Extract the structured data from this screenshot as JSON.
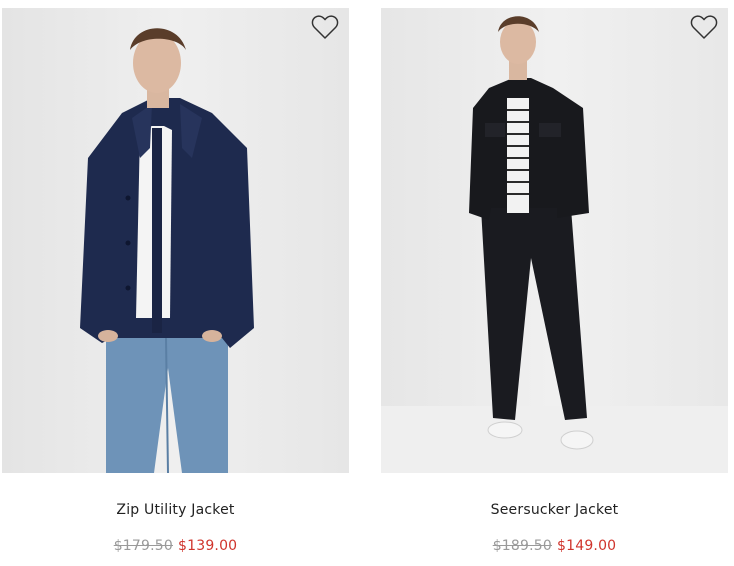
{
  "products": [
    {
      "name": "Zip Utility Jacket",
      "original_price": "$179.50",
      "sale_price": "$139.00",
      "wishlist_icon": "heart-outline-icon"
    },
    {
      "name": "Seersucker Jacket",
      "original_price": "$189.50",
      "sale_price": "$149.00",
      "wishlist_icon": "heart-outline-icon"
    }
  ],
  "colors": {
    "name_text": "#222222",
    "original_price": "#9a9a9a",
    "sale_price": "#d0342c",
    "photo_background": "#ececec",
    "jacket_navy": "#1e2a4e",
    "jacket_black": "#18191d",
    "jeans_blue": "#6e93b8"
  }
}
